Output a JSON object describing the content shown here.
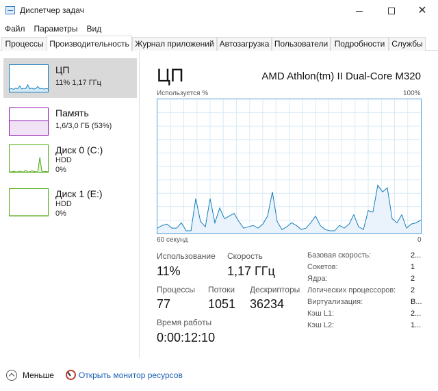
{
  "window": {
    "title": "Диспетчер задач",
    "controls": {
      "minimize_icon": "minimize-icon",
      "maximize_icon": "maximize-icon",
      "close_icon": "close-icon"
    }
  },
  "menu": [
    "Файл",
    "Параметры",
    "Вид"
  ],
  "tabs": [
    {
      "label": "Процессы",
      "active": false
    },
    {
      "label": "Производительность",
      "active": true
    },
    {
      "label": "Журнал приложений",
      "active": false
    },
    {
      "label": "Автозагрузка",
      "active": false
    },
    {
      "label": "Пользователи",
      "active": false
    },
    {
      "label": "Подробности",
      "active": false
    },
    {
      "label": "Службы",
      "active": false
    }
  ],
  "sidebar": {
    "items": [
      {
        "title": "ЦП",
        "line1": "11% 1,17 ГГц",
        "line2": "",
        "selected": true,
        "color": "#117dbb",
        "history": [
          10,
          12,
          9,
          14,
          11,
          22,
          10,
          13,
          12,
          26,
          11,
          14,
          10,
          12,
          20,
          11,
          13,
          10,
          12,
          11
        ]
      },
      {
        "title": "Память",
        "line1": "1,6/3,0 ГБ (53%)",
        "line2": "",
        "selected": false,
        "color": "#8b12ae",
        "history": [
          53,
          53,
          53,
          53,
          53,
          53,
          53,
          53,
          53,
          53,
          53,
          53,
          53,
          53,
          53,
          53,
          53,
          53,
          53,
          53
        ]
      },
      {
        "title": "Диск 0 (C:)",
        "line1": "HDD",
        "line2": "0%",
        "selected": false,
        "color": "#4da60c",
        "history": [
          0,
          0,
          2,
          0,
          0,
          3,
          0,
          0,
          6,
          0,
          0,
          4,
          2,
          0,
          0,
          55,
          3,
          0,
          2,
          0
        ]
      },
      {
        "title": "Диск 1 (E:)",
        "line1": "HDD",
        "line2": "0%",
        "selected": false,
        "color": "#4da60c",
        "history": [
          0,
          0,
          0,
          0,
          0,
          0,
          0,
          0,
          0,
          0,
          0,
          0,
          0,
          0,
          0,
          0,
          0,
          0,
          0,
          0
        ]
      }
    ]
  },
  "main": {
    "title": "ЦП",
    "model": "AMD Athlon(tm) II Dual-Core M320",
    "graph_label_left": "Используется %",
    "graph_label_right": "100%",
    "axis_left": "60 секунд",
    "axis_right": "0",
    "utilization_history": [
      4,
      6,
      7,
      4,
      4,
      8,
      2,
      2,
      26,
      9,
      5,
      26,
      8,
      19,
      11,
      13,
      15,
      9,
      4,
      5,
      6,
      4,
      7,
      13,
      31,
      9,
      3,
      5,
      8,
      6,
      3,
      4,
      8,
      13,
      6,
      3,
      2,
      2,
      6,
      4,
      7,
      14,
      5,
      3,
      17,
      16,
      36,
      31,
      34,
      11,
      8,
      14,
      4,
      7,
      8,
      10
    ]
  },
  "stats": {
    "utilization_label": "Использование",
    "utilization_value": "11%",
    "speed_label": "Скорость",
    "speed_value": "1,17 ГГц",
    "processes_label": "Процессы",
    "processes_value": "77",
    "threads_label": "Потоки",
    "threads_value": "1051",
    "handles_label": "Дескрипторы",
    "handles_value": "36234",
    "uptime_label": "Время работы",
    "uptime_value": "0:00:12:10"
  },
  "specs": [
    {
      "label": "Базовая скорость:",
      "value": "2..."
    },
    {
      "label": "Сокетов:",
      "value": "1"
    },
    {
      "label": "Ядра:",
      "value": "2"
    },
    {
      "label": "Логических процессоров:",
      "value": "2"
    },
    {
      "label": "Виртуализация:",
      "value": "В..."
    },
    {
      "label": "Кэш L1:",
      "value": "2..."
    },
    {
      "label": "Кэш L2:",
      "value": "1..."
    }
  ],
  "footer": {
    "less_label": "Меньше",
    "monitor_link": "Открыть монитор ресурсов"
  }
}
